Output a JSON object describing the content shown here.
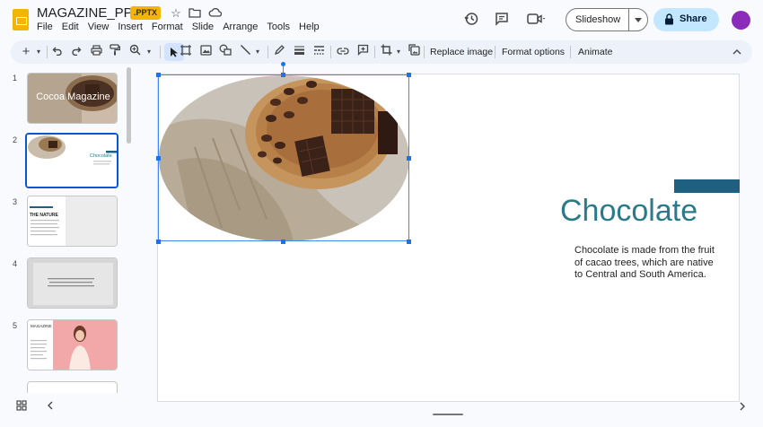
{
  "app": {
    "title": "MAGAZINE_PPTX",
    "badge": ".PPTX",
    "menu": [
      "File",
      "Edit",
      "View",
      "Insert",
      "Format",
      "Slide",
      "Arrange",
      "Tools",
      "Help"
    ]
  },
  "header_actions": {
    "slideshow_label": "Slideshow",
    "share_label": "Share"
  },
  "toolbar": {
    "replace_image": "Replace image",
    "format_options": "Format options",
    "animate": "Animate"
  },
  "filmstrip": {
    "slides": [
      {
        "number": "1",
        "title": "Cocoa Magazine"
      },
      {
        "number": "2",
        "title": "Chocolate"
      },
      {
        "number": "3",
        "title": "THE NATURE"
      },
      {
        "number": "4",
        "title": ""
      },
      {
        "number": "5",
        "title": "MAGAZINE"
      }
    ]
  },
  "slide": {
    "title": "Chocolate",
    "body": "Chocolate is made from the fruit of cacao trees, which are native to Central and South America."
  },
  "colors": {
    "accent_bar": "#1f5f80",
    "title": "#2b7a8a",
    "share_bg": "#c2e7ff",
    "selection": "#1a73e8"
  }
}
